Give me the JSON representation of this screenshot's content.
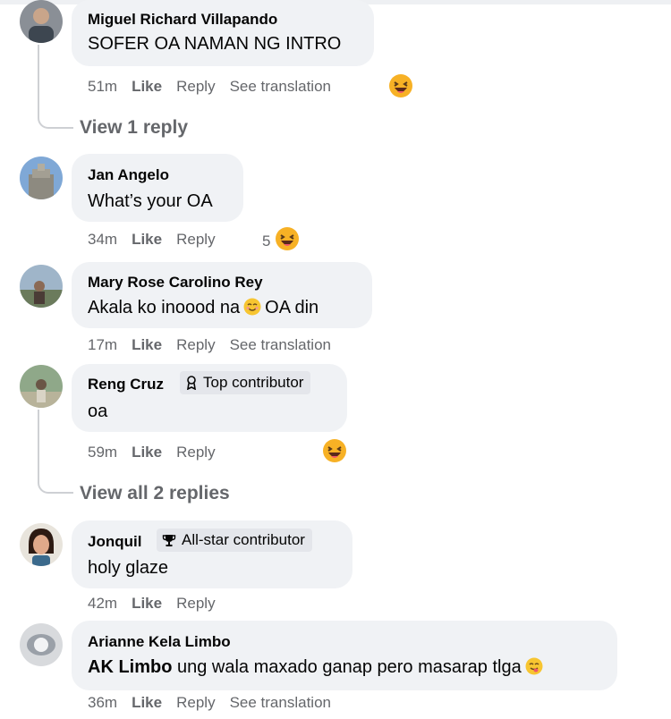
{
  "comments": [
    {
      "author": "Miguel Richard Villapando",
      "text": "SOFER OA NAMAN NG INTRO",
      "time": "51m",
      "like": "Like",
      "reply": "Reply",
      "translate": "See translation",
      "reaction_icon": "haha-emoji-icon"
    },
    {
      "author": "Jan Angelo",
      "text": "What’s your OA",
      "time": "34m",
      "like": "Like",
      "reply": "Reply",
      "reaction_count": "5",
      "reaction_icon": "haha-emoji-icon"
    },
    {
      "author": "Mary Rose Carolino Rey",
      "text_before": "Akala ko inoood na",
      "text_after": "OA din",
      "inline_emoji": "smile-emoji-icon",
      "time": "17m",
      "like": "Like",
      "reply": "Reply",
      "translate": "See translation"
    },
    {
      "author": "Reng Cruz",
      "badge": "Top contributor",
      "badge_icon": "contributor-icon",
      "text": "oa",
      "time": "59m",
      "like": "Like",
      "reply": "Reply",
      "reaction_icon": "haha-emoji-icon"
    },
    {
      "author": "Jonquil",
      "badge": "All-star contributor",
      "badge_icon": "trophy-icon",
      "text": "holy glaze",
      "time": "42m",
      "like": "Like",
      "reply": "Reply"
    },
    {
      "author": "Arianne Kela Limbo",
      "mention": "AK Limbo",
      "text": "ung wala maxado ganap pero masarap tlga",
      "inline_emoji": "yum-emoji-icon",
      "time": "36m",
      "like": "Like",
      "reply": "Reply",
      "translate": "See translation"
    }
  ],
  "view_replies": [
    "View 1 reply",
    "View all 2 replies"
  ],
  "colors": {
    "bubble": "#f0f2f5",
    "meta": "#65676b",
    "reaction": "#f7b125"
  }
}
